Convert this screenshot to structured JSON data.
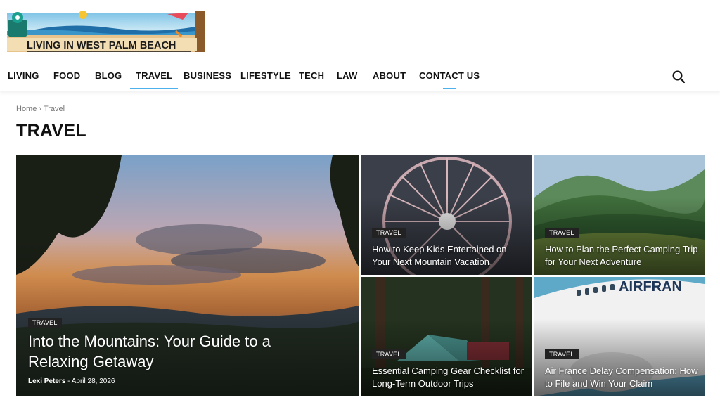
{
  "site": {
    "logo_text": "LIVING IN WEST PALM BEACH"
  },
  "nav": {
    "items": [
      {
        "label": "LIVING"
      },
      {
        "label": "FOOD"
      },
      {
        "label": "BLOG"
      },
      {
        "label": "TRAVEL"
      },
      {
        "label": "BUSINESS"
      },
      {
        "label": "LIFESTYLE"
      },
      {
        "label": "TECH"
      },
      {
        "label": "LAW"
      },
      {
        "label": "ABOUT"
      },
      {
        "label": "CONTACT US"
      }
    ],
    "active": "TRAVEL",
    "search_icon": "search-icon"
  },
  "breadcrumb": {
    "home": "Home",
    "separator": "›",
    "current": "Travel"
  },
  "page": {
    "title": "TRAVEL"
  },
  "articles": [
    {
      "category": "TRAVEL",
      "title": "Into the Mountains: Your Guide to a Relaxing Getaway",
      "author": "Lexi Peters",
      "separator": "-",
      "date": "April 28, 2026"
    },
    {
      "category": "TRAVEL",
      "title": "How to Keep Kids Entertained on Your Next Mountain Vacation"
    },
    {
      "category": "TRAVEL",
      "title": "How to Plan the Perfect Camping Trip for Your Next Adventure"
    },
    {
      "category": "TRAVEL",
      "title": "Essential Camping Gear Checklist for Long-Term Outdoor Trips"
    },
    {
      "category": "TRAVEL",
      "title": "Air France Delay Compensation: How to File and Win Your Claim"
    }
  ],
  "colors": {
    "accent": "#4db2ec",
    "badge": "#222222",
    "text": "#111111"
  }
}
